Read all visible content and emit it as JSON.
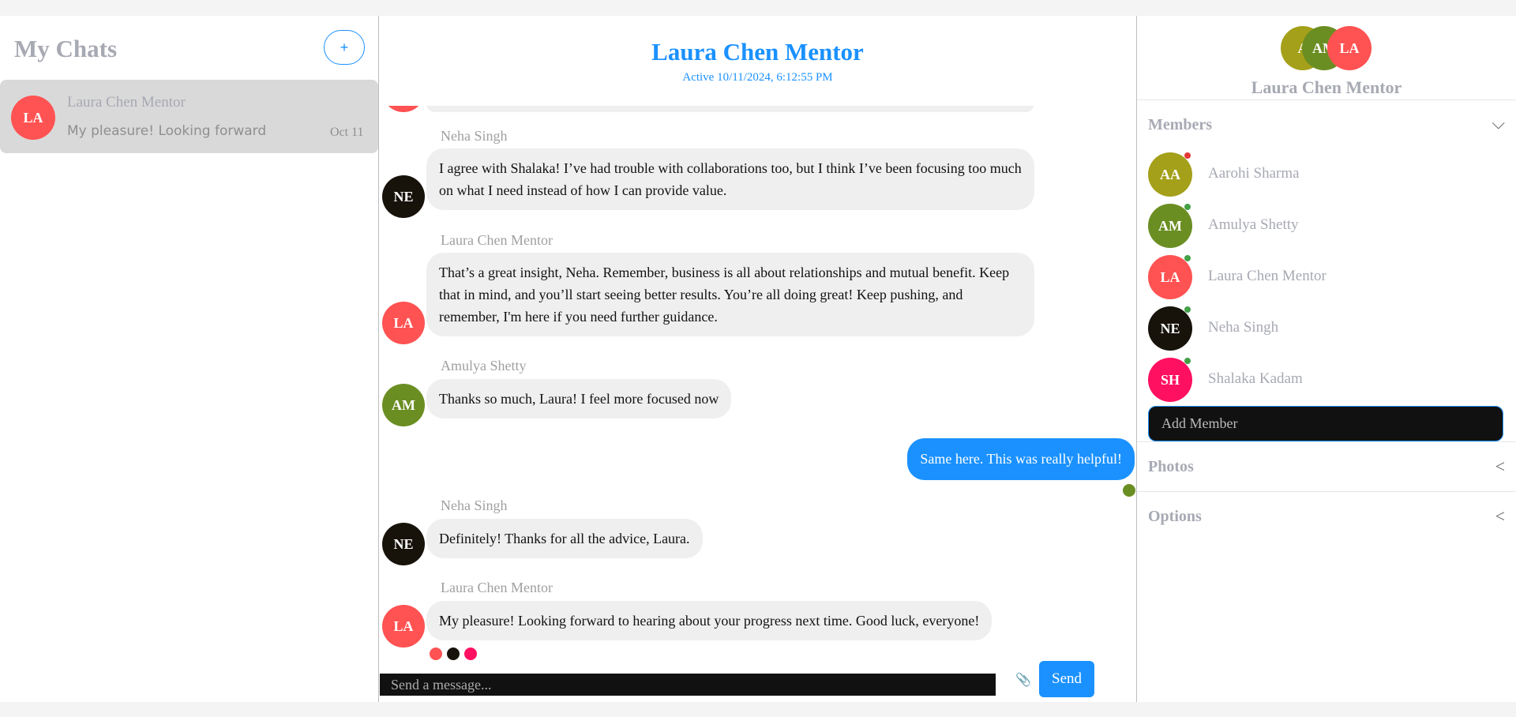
{
  "sidebar": {
    "title": "My Chats",
    "new_chat_label": "+",
    "chats": [
      {
        "initials": "LA",
        "name": "Laura Chen Mentor",
        "preview": "My pleasure! Looking forward to hearing about your progress next time. Good luck, everyone!",
        "date": "Oct 11",
        "color": "#ff5252"
      }
    ]
  },
  "chat": {
    "title": "Laura Chen Mentor",
    "active": "Active 10/11/2024, 6:12:55 PM",
    "messages": [
      {
        "sender": "Neha Singh",
        "initials": "NE",
        "color": "#17120a",
        "text": "I agree with Shalaka! I’ve had trouble with collaborations too, but I think I’ve been focusing too much on what I need instead of how I can provide value."
      },
      {
        "sender": "Laura Chen Mentor",
        "initials": "LA",
        "color": "#ff5252",
        "text": "That’s a great insight, Neha. Remember, business is all about relationships and mutual benefit. Keep that in mind, and you’ll start seeing better results. You’re all doing great! Keep pushing, and remember, I'm here if you need further guidance."
      },
      {
        "sender": "Amulya Shetty",
        "initials": "AM",
        "color": "#6b8e23",
        "text": "Thanks so much, Laura! I feel more focused now"
      },
      {
        "self": true,
        "text": "Same here. This was really helpful!"
      },
      {
        "sender": "Neha Singh",
        "initials": "NE",
        "color": "#17120a",
        "text": "Definitely! Thanks for all the advice, Laura."
      },
      {
        "sender": "Laura Chen Mentor",
        "initials": "LA",
        "color": "#ff5252",
        "text": "My pleasure! Looking forward to hearing about your progress next time. Good luck, everyone!"
      }
    ],
    "composer_placeholder": "Send a message...",
    "attach_icon": "📎",
    "send_label": "Send"
  },
  "details": {
    "group_avatars": [
      {
        "initials": "A",
        "color": "#a4a01a"
      },
      {
        "initials": "AM",
        "color": "#6b8e23"
      },
      {
        "initials": "LA",
        "color": "#ff5252"
      }
    ],
    "name": "Laura Chen Mentor",
    "members_title": "Members",
    "members": [
      {
        "initials": "AA",
        "name": "Aarohi Sharma",
        "color": "#a4a01a",
        "status": "#e53935"
      },
      {
        "initials": "AM",
        "name": "Amulya Shetty",
        "color": "#6b8e23",
        "status": "#43a047"
      },
      {
        "initials": "LA",
        "name": "Laura Chen Mentor",
        "color": "#ff5252",
        "status": "#43a047"
      },
      {
        "initials": "NE",
        "name": "Neha Singh",
        "color": "#17120a",
        "status": "#43a047"
      },
      {
        "initials": "SH",
        "name": "Shalaka Kadam",
        "color": "#ff1060",
        "status": "#43a047"
      }
    ],
    "add_member_placeholder": "Add Member",
    "photos_title": "Photos",
    "options_title": "Options",
    "chevron_down": "⌵",
    "chevron_left": "<"
  }
}
